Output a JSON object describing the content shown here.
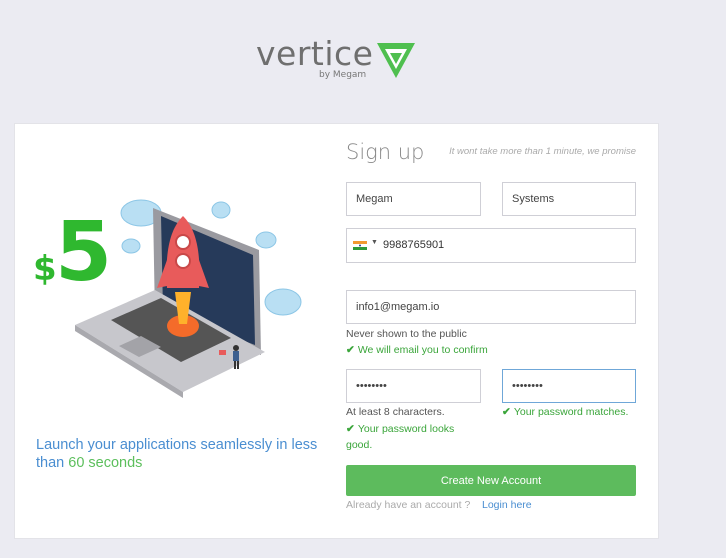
{
  "brand": {
    "name": "vertice",
    "byline": "by Megam",
    "mark_color": "#4fbf4f"
  },
  "promo": {
    "price": "$5",
    "tagline_prefix": "Launch your applications seamlessly in less than ",
    "tagline_highlight": "60 seconds"
  },
  "form": {
    "title": "Sign up",
    "subtitle": "It wont take more than 1 minute, we promise",
    "first_name": "Megam",
    "last_name": "Systems",
    "phone_country_icon": "india-flag-icon",
    "phone": "9988765901",
    "email": "info1@megam.io",
    "email_help": "Never shown to the public",
    "email_ok": "We will email you to confirm",
    "password": "••••••••",
    "password_help": "At least 8 characters.",
    "password_ok": "Your password looks good.",
    "confirm_password": "••••••••",
    "confirm_ok": "Your password matches.",
    "submit_label": "Create New Account",
    "already_text": "Already have an account ?",
    "login_label": "Login here"
  },
  "colors": {
    "accent_green": "#5dbb5d",
    "link_blue": "#4a8ed1",
    "ok_green": "#3aa53a"
  }
}
